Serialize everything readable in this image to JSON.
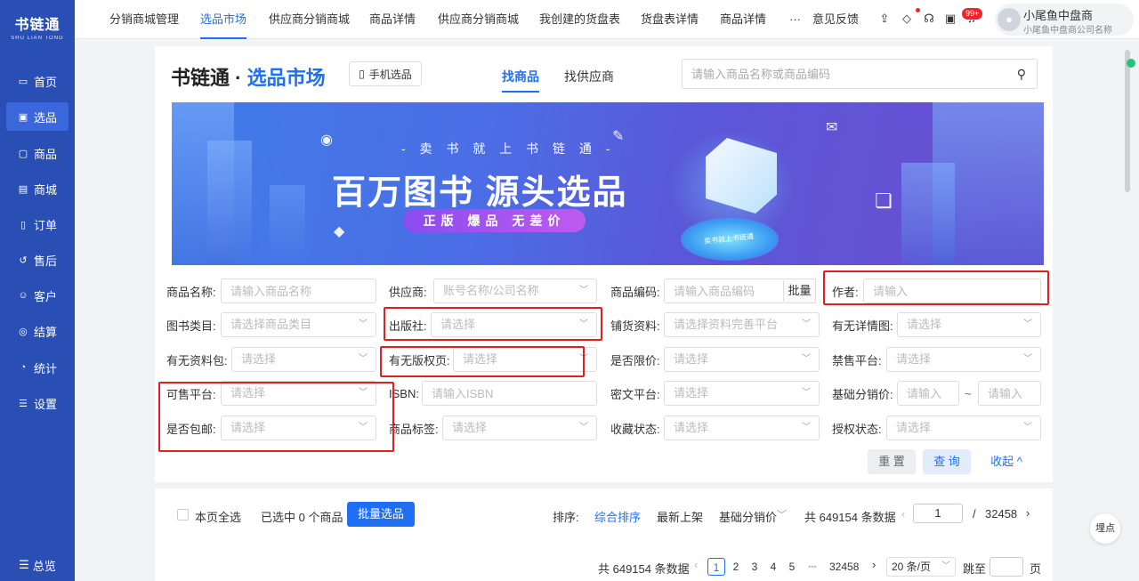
{
  "sidebar": {
    "logo_cn": "书链通",
    "logo_en": "SHU LIAN TONG",
    "items": [
      {
        "label": "首页",
        "icon": "monitor-icon"
      },
      {
        "label": "选品",
        "icon": "select-icon"
      },
      {
        "label": "商品",
        "icon": "product-icon"
      },
      {
        "label": "商城",
        "icon": "store-icon"
      },
      {
        "label": "订单",
        "icon": "order-icon"
      },
      {
        "label": "售后",
        "icon": "aftersale-icon"
      },
      {
        "label": "客户",
        "icon": "customer-icon"
      },
      {
        "label": "结算",
        "icon": "settlement-icon"
      },
      {
        "label": "统计",
        "icon": "stats-icon"
      },
      {
        "label": "设置",
        "icon": "settings-icon"
      }
    ],
    "active_index": 1,
    "bottom_label": "总览"
  },
  "topbar": {
    "tabs": [
      "分销商城管理",
      "选品市场",
      "供应商分销商城",
      "商品详情",
      "供应商分销商城",
      "我创建的货盘表",
      "货盘表详情",
      "商品详情"
    ],
    "active_tab": 1,
    "more": "···",
    "feedback": "意见反馈",
    "badge": "99+",
    "user_name": "小尾鱼中盘商",
    "user_company": "小尾鱼中盘商公司名称"
  },
  "header": {
    "brand_prefix": "书链通 · ",
    "brand_highlight": "选品市场",
    "mobile_btn": "手机选品",
    "mode_tabs": [
      "找商品",
      "找供应商"
    ],
    "search_placeholder": "请输入商品名称或商品编码"
  },
  "banner": {
    "slogan_small": "- 卖 书 就 上 书 链 通 -",
    "slogan_big": "百万图书  源头选品",
    "pill": "正版 爆品 无差价",
    "stage_label": "卖书就上书链通"
  },
  "filters": {
    "product_name": {
      "label": "商品名称:",
      "placeholder": "请输入商品名称"
    },
    "supplier": {
      "label": "供应商:",
      "placeholder": "账号名称/公司名称"
    },
    "product_code": {
      "label": "商品编码:",
      "placeholder": "请输入商品编码",
      "batch": "批量"
    },
    "author": {
      "label": "作者:",
      "placeholder": "请输入"
    },
    "book_category": {
      "label": "图书类目:",
      "placeholder": "请选择商品类目"
    },
    "publisher": {
      "label": "出版社:",
      "placeholder": "请选择"
    },
    "supply_material": {
      "label": "铺货资料:",
      "placeholder": "请选择资料完善平台"
    },
    "has_detail_image": {
      "label": "有无详情图:",
      "placeholder": "请选择"
    },
    "has_material_pack": {
      "label": "有无资料包:",
      "placeholder": "请选择"
    },
    "has_copyright_page": {
      "label": "有无版权页:",
      "placeholder": "请选择"
    },
    "price_limited": {
      "label": "是否限价:",
      "placeholder": "请选择"
    },
    "banned_platform": {
      "label": "禁售平台:",
      "placeholder": "请选择"
    },
    "sellable_platform": {
      "label": "可售平台:",
      "placeholder": "请选择"
    },
    "isbn": {
      "label": "ISBN:",
      "placeholder": "请输入ISBN"
    },
    "cipher_platform": {
      "label": "密文平台:",
      "placeholder": "请选择"
    },
    "base_price": {
      "label": "基础分销价:",
      "placeholder_min": "请输入",
      "separator": "~",
      "placeholder_max": "请输入"
    },
    "free_shipping": {
      "label": "是否包邮:",
      "placeholder": "请选择"
    },
    "product_tag": {
      "label": "商品标签:",
      "placeholder": "请选择"
    },
    "favorite_status": {
      "label": "收藏状态:",
      "placeholder": "请选择"
    },
    "auth_status": {
      "label": "授权状态:",
      "placeholder": "请选择"
    }
  },
  "actions": {
    "reset": "重 置",
    "query": "查 询",
    "collapse": "收起 ^"
  },
  "toolbar": {
    "select_page": "本页全选",
    "selected": "已选中 0 个商品",
    "batch_select": "批量选品",
    "sort_label": "排序:",
    "sort_options": [
      "综合排序",
      "最新上架",
      "基础分销价"
    ],
    "total_text": "共 649154 条数据",
    "page_current": "1",
    "page_separator": "/",
    "page_total": "32458"
  },
  "pagination": {
    "total_text": "共 649154 条数据",
    "pages": [
      "1",
      "2",
      "3",
      "4",
      "5"
    ],
    "ellipsis": "•••",
    "last_page": "32458",
    "page_size": "20 条/页",
    "jump_label": "跳至",
    "page_unit": "页"
  },
  "float_button": "埋点",
  "colors": {
    "primary": "#1f6ff5",
    "sidebar": "#2a4fb4",
    "highlight_box": "#e02020"
  }
}
